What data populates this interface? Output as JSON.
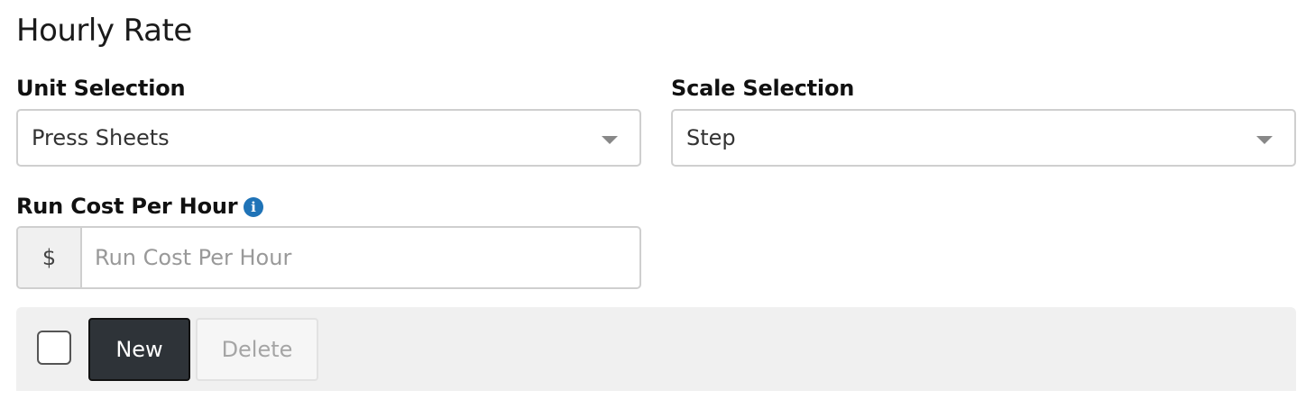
{
  "section": {
    "title": "Hourly Rate"
  },
  "unit_selection": {
    "label": "Unit Selection",
    "value": "Press Sheets"
  },
  "scale_selection": {
    "label": "Scale Selection",
    "value": "Step"
  },
  "run_cost": {
    "label": "Run Cost Per Hour",
    "currency_symbol": "$",
    "placeholder": "Run Cost Per Hour",
    "value": "",
    "info_icon": "info-circle-icon",
    "info_color": "#1f73b7"
  },
  "toolbar": {
    "select_all_checked": false,
    "new_label": "New",
    "delete_label": "Delete",
    "new_color": "#2e3338"
  }
}
